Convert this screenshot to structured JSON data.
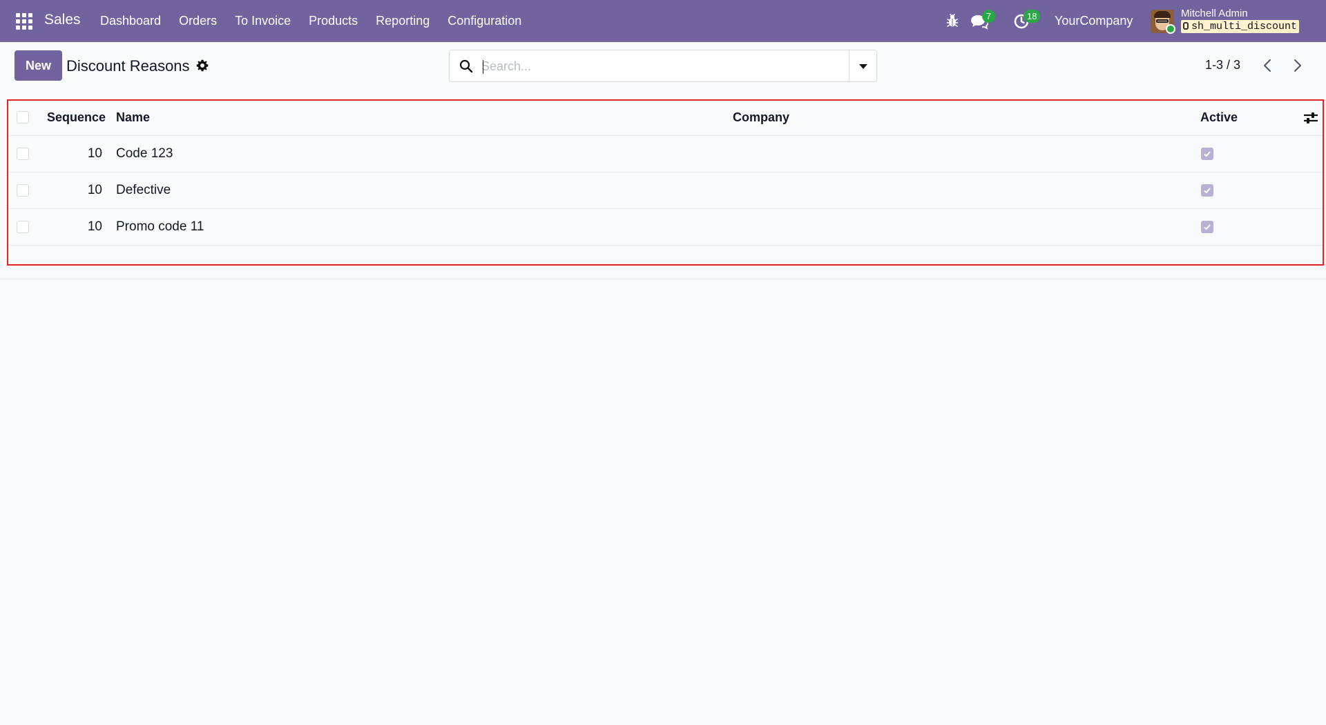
{
  "navbar": {
    "app_name": "Sales",
    "menu": [
      "Dashboard",
      "Orders",
      "To Invoice",
      "Products",
      "Reporting",
      "Configuration"
    ],
    "messages_count": "7",
    "activities_count": "18",
    "company": "YourCompany",
    "user_name": "Mitchell Admin",
    "database": "sh_multi_discount",
    "accent_color": "#71639e"
  },
  "control_panel": {
    "new_label": "New",
    "title": "Discount Reasons",
    "search_placeholder": "Search...",
    "pager": "1-3 / 3"
  },
  "list": {
    "columns": [
      "Sequence",
      "Name",
      "Company",
      "Active"
    ],
    "rows": [
      {
        "sequence": "10",
        "name": "Code 123",
        "company": "",
        "active": true
      },
      {
        "sequence": "10",
        "name": "Defective",
        "company": "",
        "active": true
      },
      {
        "sequence": "10",
        "name": "Promo code 11",
        "company": "",
        "active": true
      }
    ]
  },
  "icons": {
    "apps": "apps-grid-icon",
    "debug": "bug-icon",
    "messages": "chat-icon",
    "activities": "clock-icon",
    "settings": "gear-icon",
    "search": "search-icon",
    "optional_columns": "sliders-icon"
  }
}
